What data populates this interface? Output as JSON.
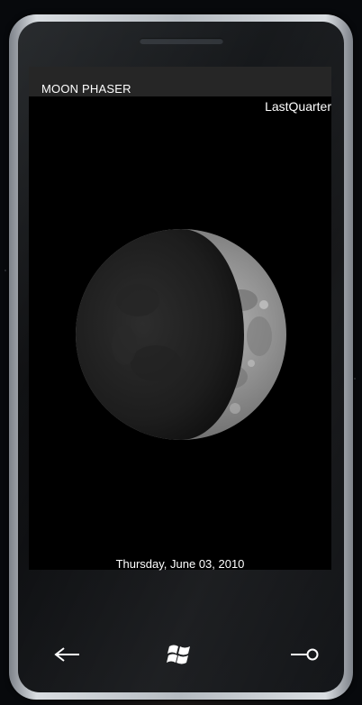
{
  "app": {
    "title": "MOON PHASER"
  },
  "moon": {
    "phase_name": "LastQuarter",
    "date": "Thursday, June 03, 2010"
  },
  "hardware_buttons": [
    {
      "name": "back",
      "icon": "back-arrow-icon"
    },
    {
      "name": "start",
      "icon": "windows-logo-icon"
    },
    {
      "name": "search",
      "icon": "search-icon"
    }
  ],
  "colors": {
    "screen_bg": "#000000",
    "title_bar_bg": "#262626",
    "text": "#ffffff"
  }
}
